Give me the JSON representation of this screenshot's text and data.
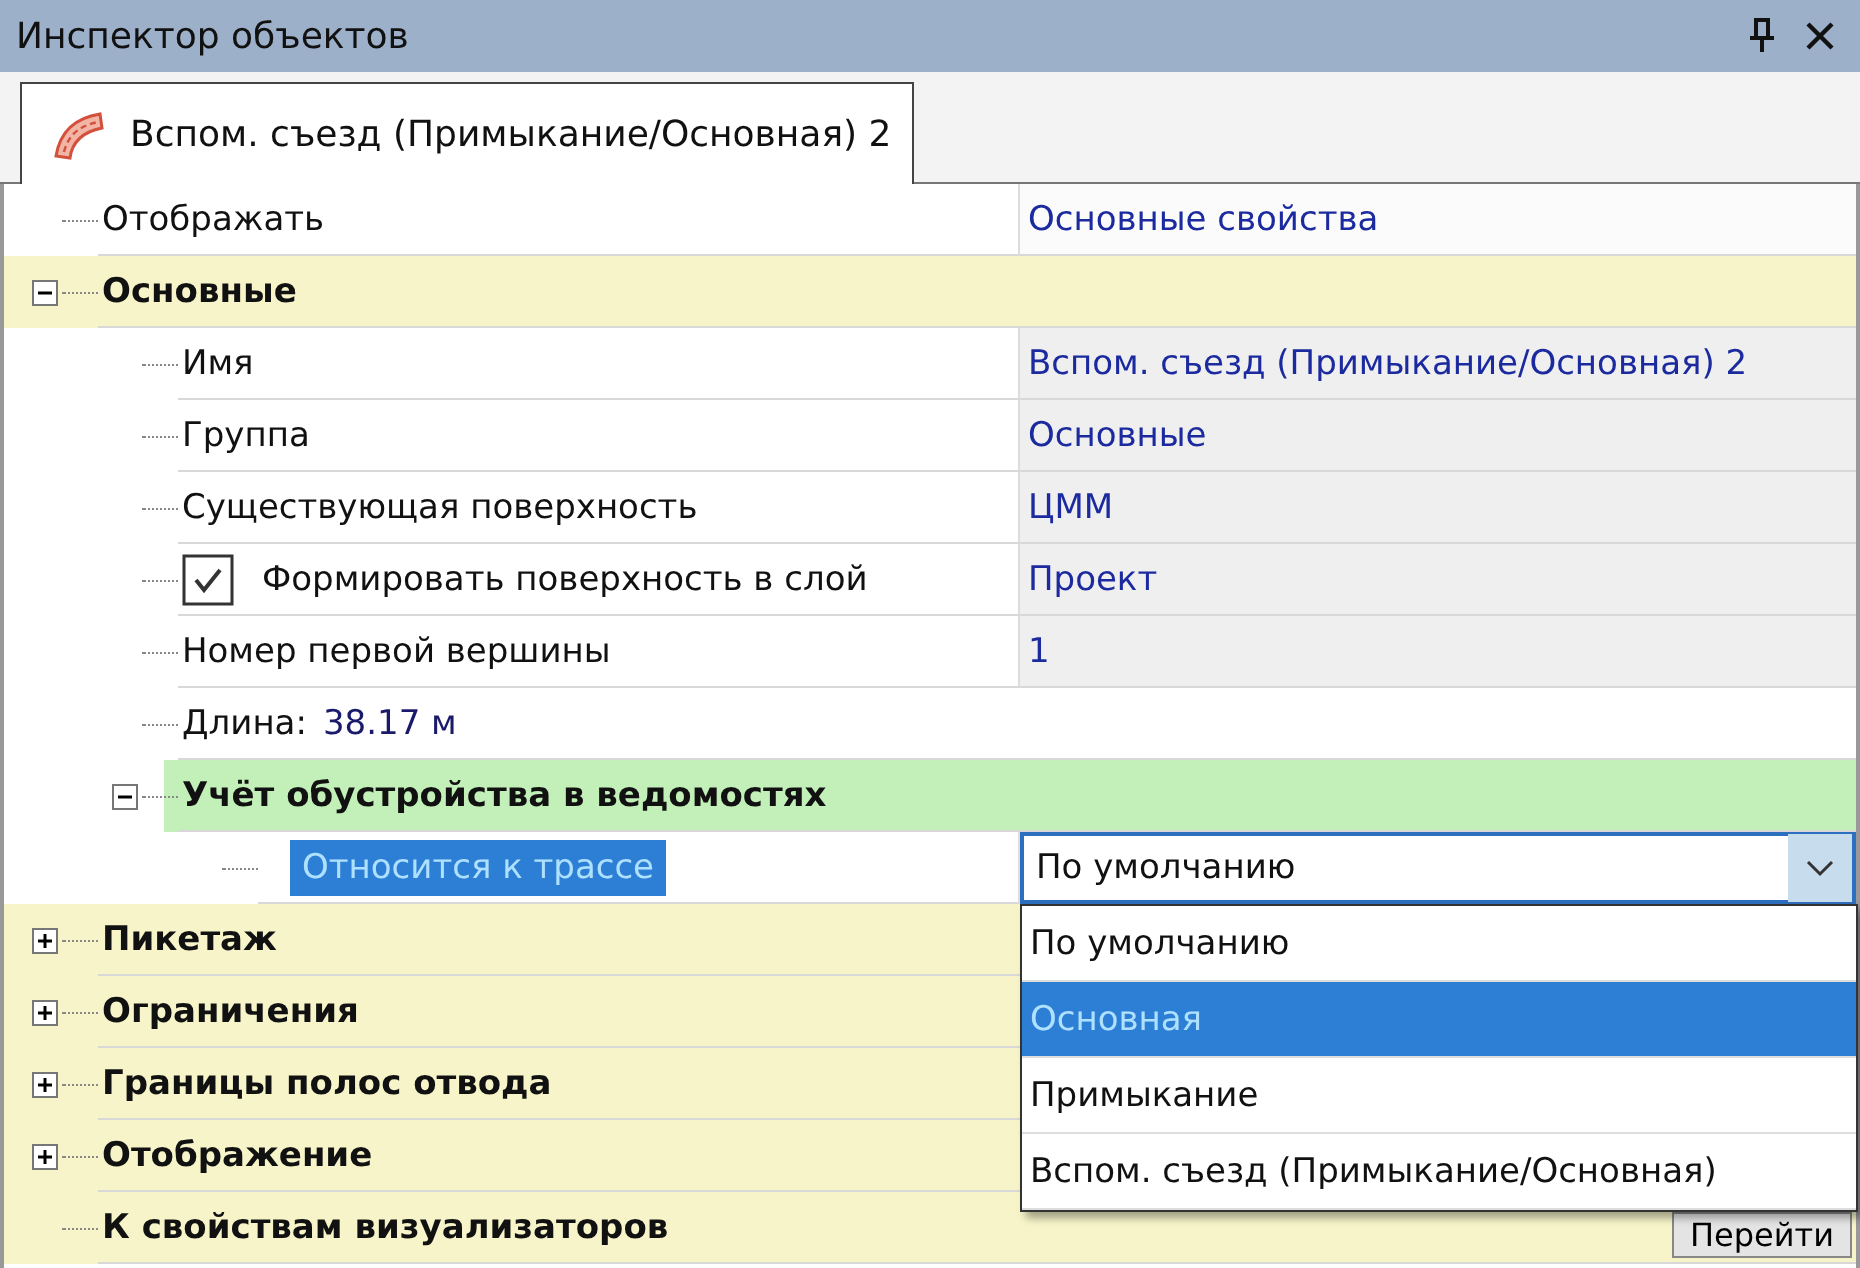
{
  "window": {
    "title": "Инспектор объектов"
  },
  "tab": {
    "label": "Вспом. съезд (Примыкание/Основная) 2",
    "selected": true
  },
  "rows": [
    {
      "kind": "property",
      "label": "Отображать",
      "value": "Основные свойства"
    },
    {
      "kind": "category",
      "label": "Основные",
      "expanded": true,
      "children": [
        {
          "kind": "property",
          "label": "Имя",
          "value": "Вспом. съезд (Примыкание/Основная) 2"
        },
        {
          "kind": "property",
          "label": "Группа",
          "value": "Основные"
        },
        {
          "kind": "property",
          "label": "Существующая поверхность",
          "value": "ЦММ"
        },
        {
          "kind": "checkbox",
          "label": "Формировать поверхность в слой",
          "checked": true,
          "value": "Проект"
        },
        {
          "kind": "property",
          "label": "Номер первой вершины",
          "value": "1"
        },
        {
          "kind": "info",
          "label": "Длина:",
          "value": "38.17 м"
        },
        {
          "kind": "subcategory",
          "label": "Учёт обустройства в ведомостях",
          "expanded": true,
          "children": [
            {
              "kind": "dropdown",
              "label": "Относится к трассе",
              "selected": true,
              "value": "По умолчанию",
              "open": true,
              "options": [
                {
                  "label": "По умолчанию",
                  "highlighted": false
                },
                {
                  "label": "Основная",
                  "highlighted": true
                },
                {
                  "label": "Примыкание",
                  "highlighted": false
                },
                {
                  "label": "Вспом. съезд (Примыкание/Основная)",
                  "highlighted": false
                }
              ]
            }
          ]
        }
      ]
    },
    {
      "kind": "category",
      "label": "Пикетаж",
      "expanded": false
    },
    {
      "kind": "category",
      "label": "Ограничения",
      "expanded": false
    },
    {
      "kind": "category",
      "label": "Границы полос отвода",
      "expanded": false
    },
    {
      "kind": "category",
      "label": "Отображение",
      "expanded": false
    },
    {
      "kind": "link",
      "label": "К свойствам визуализаторов",
      "button": "Перейти"
    }
  ]
}
